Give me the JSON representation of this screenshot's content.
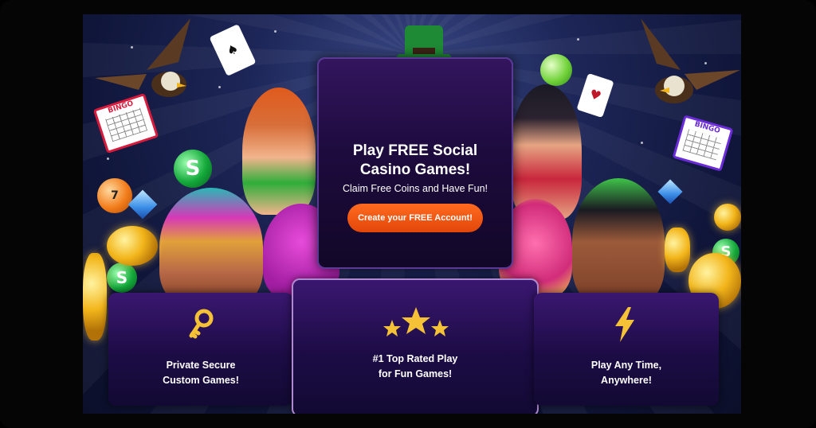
{
  "hero": {
    "title_line1": "Play FREE Social",
    "title_line2": "Casino Games!",
    "subtitle": "Claim Free Coins and Have Fun!",
    "cta_label": "Create your FREE Account!"
  },
  "features": [
    {
      "line1": "Private Secure",
      "line2": "Custom Games!",
      "icon": "key-icon"
    },
    {
      "line1": "#1 Top Rated Play",
      "line2": "for Fun Games!",
      "icon": "stars-icon"
    },
    {
      "line1": "Play Any Time,",
      "line2": "Anywhere!",
      "icon": "lightning-icon"
    }
  ],
  "decor": {
    "bingo_label": "BINGO",
    "coin_symbol": "S",
    "ball_number": "7"
  },
  "colors": {
    "accent": "#f25a14",
    "panel": "#1d0b3d",
    "gold": "#f2b51a"
  }
}
